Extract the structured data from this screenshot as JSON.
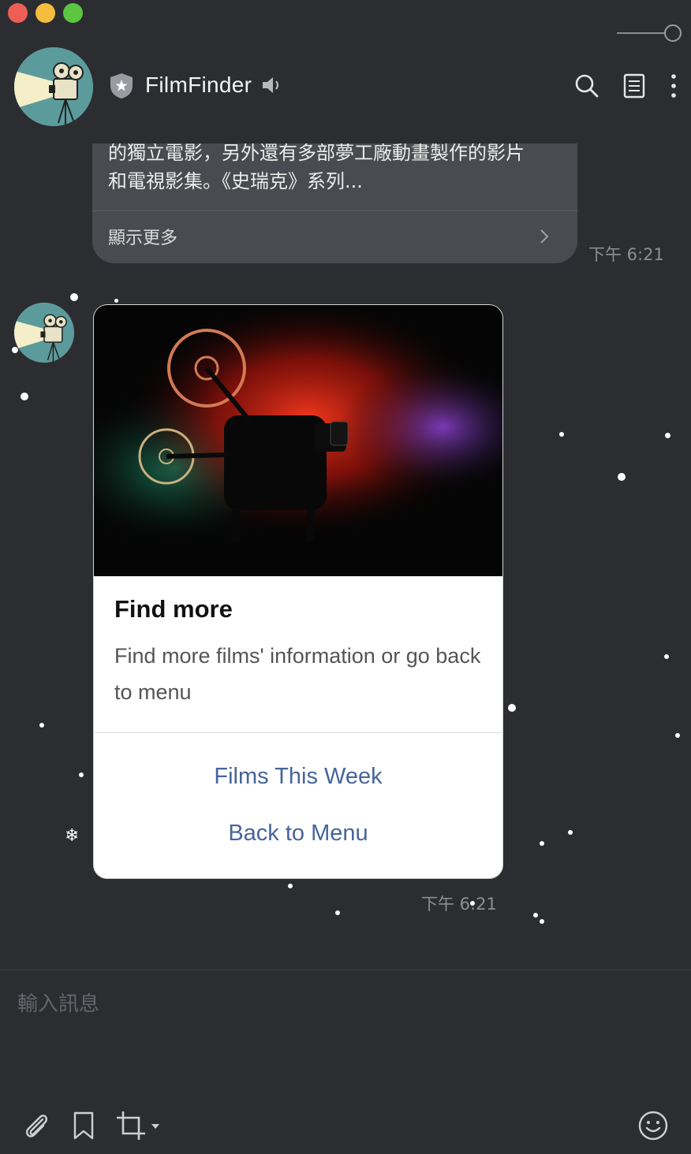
{
  "window": {
    "controls": [
      "close",
      "minimize",
      "maximize"
    ]
  },
  "header": {
    "chat_name": "FilmFinder",
    "icons": [
      "shield-star-icon",
      "speaker-icon",
      "search-icon",
      "notes-icon",
      "more-vertical-icon"
    ]
  },
  "messages": {
    "previous": {
      "text_line1": "的獨立電影，另外還有多部夢工廠動畫製作的影片",
      "text_line2": "和電視影集。《史瑞克》系列...",
      "show_more": "顯示更多",
      "time": "下午 6:21"
    },
    "card": {
      "title": "Find more",
      "description": "Find more films' information or go back to menu",
      "buttons": [
        "Films This Week",
        "Back to Menu"
      ],
      "time": "下午 6:21"
    }
  },
  "composer": {
    "placeholder": "輸入訊息",
    "tools": [
      "attach-icon",
      "bookmark-icon",
      "crop-icon",
      "emoji-icon"
    ]
  },
  "colors": {
    "background": "#2c2d31",
    "bubble": "#4a4b50",
    "link": "#46659b"
  }
}
